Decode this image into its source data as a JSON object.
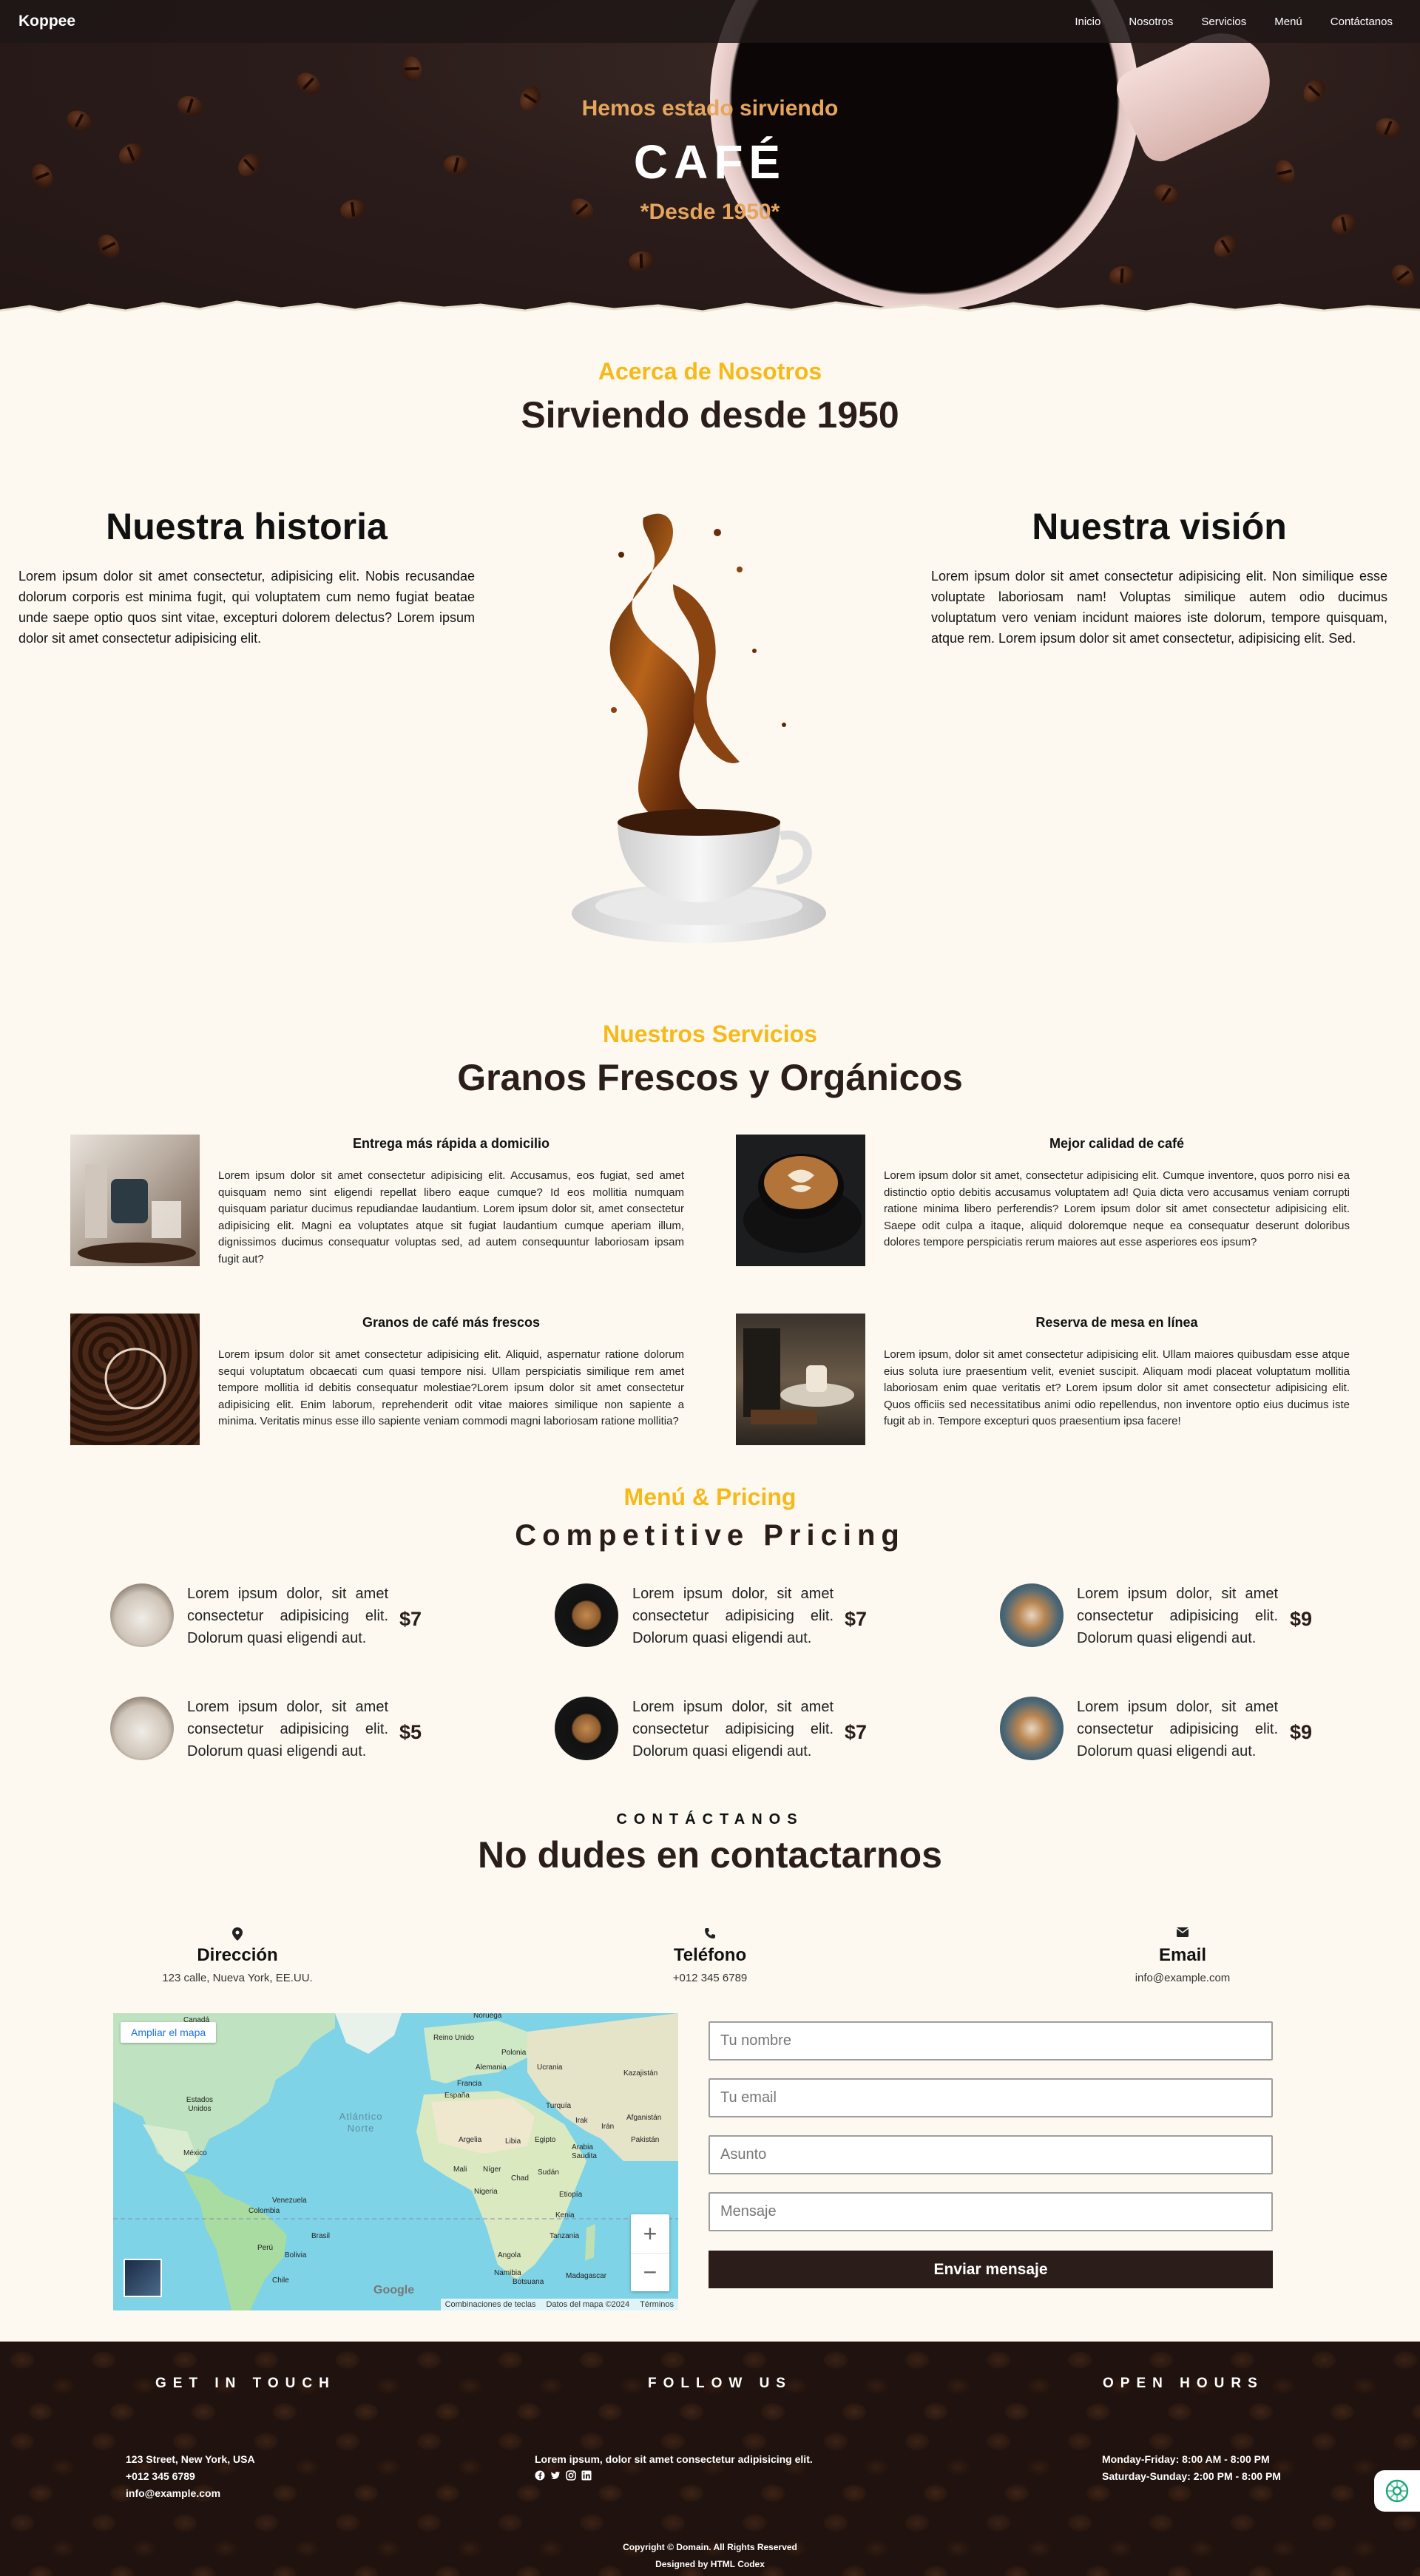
{
  "nav": {
    "brand": "Koppee",
    "links": [
      "Inicio",
      "Nosotros",
      "Servicios",
      "Menú",
      "Contáctanos"
    ]
  },
  "hero": {
    "subtitle": "Hemos estado sirviendo",
    "title": "CAFÉ",
    "since": "*Desde 1950*"
  },
  "about": {
    "kicker": "Acerca de Nosotros",
    "heading": "Sirviendo desde 1950",
    "history_title": "Nuestra historia",
    "history_text": "Lorem ipsum dolor sit amet consectetur, adipisicing elit. Nobis recusandae dolorum corporis est minima fugit, qui voluptatem cum nemo fugiat beatae unde saepe optio quos sint vitae, excepturi dolorem delectus? Lorem ipsum dolor sit amet consectetur adipisicing elit.",
    "vision_title": "Nuestra visión",
    "vision_text": "Lorem ipsum dolor sit amet consectetur adipisicing elit. Non similique esse voluptate laboriosam nam! Voluptas similique autem odio ducimus voluptatum vero veniam incidunt maiores iste dolorum, tempore quisquam, atque rem. Lorem ipsum dolor sit amet consectetur, adipisicing elit. Sed."
  },
  "services": {
    "kicker": "Nuestros Servicios",
    "heading": "Granos Frescos y Orgánicos",
    "items": [
      {
        "title": "Entrega más rápida a domicilio",
        "text": "Lorem ipsum dolor sit amet consectetur adipisicing elit. Accusamus, eos fugiat, sed amet quisquam nemo sint eligendi repellat libero eaque cumque? Id eos mollitia numquam quisquam pariatur ducimus repudiandae laudantium. Lorem ipsum dolor sit, amet consectetur adipisicing elit. Magni ea voluptates atque sit fugiat laudantium cumque aperiam illum, dignissimos ducimus consequatur voluptas sed, ad autem consequuntur laboriosam ipsam fugit aut?"
      },
      {
        "title": "Mejor calidad de café",
        "text": "Lorem ipsum dolor sit amet, consectetur adipisicing elit. Cumque inventore, quos porro nisi ea distinctio optio debitis accusamus voluptatem ad! Quia dicta vero accusamus veniam corrupti ratione minima libero perferendis? Lorem ipsum dolor sit amet consectetur adipisicing elit. Saepe odit culpa a itaque, aliquid doloremque neque ea consequatur deserunt doloribus dolores tempore perspiciatis rerum maiores aut esse asperiores eos ipsum?"
      },
      {
        "title": "Granos de café más frescos",
        "text": "Lorem ipsum dolor sit amet consectetur adipisicing elit. Aliquid, aspernatur ratione dolorum sequi voluptatum obcaecati cum quasi tempore nisi. Ullam perspiciatis similique rem amet tempore mollitia id debitis consequatur molestiae?Lorem ipsum dolor sit amet consectetur adipisicing elit. Enim laborum, reprehenderit odit vitae maiores similique non sapiente a minima. Veritatis minus esse illo sapiente veniam commodi magni laboriosam ratione mollitia?"
      },
      {
        "title": "Reserva de mesa en línea",
        "text": "Lorem ipsum, dolor sit amet consectetur adipisicing elit. Ullam maiores quibusdam esse atque eius soluta iure praesentium velit, eveniet suscipit. Aliquam modi placeat voluptatum mollitia laboriosam enim quae veritatis et? Lorem ipsum dolor sit amet consectetur adipisicing elit. Quos officiis sed necessitatibus animi odio repellendus, non inventore optio eius ducimus iste fugit ab in. Tempore excepturi quos praesentium ipsa facere!"
      }
    ]
  },
  "menu": {
    "kicker": "Menú & Pricing",
    "heading": "Competitive Pricing",
    "item_text": "Lorem ipsum, dolor, sit amet consectetur adipisicing elit. Dolorum quasi eligendi aut.",
    "items": [
      {
        "text": "Lorem ipsum dolor, sit amet consectetur adipisicing elit. Dolorum quasi eligendi aut.",
        "price": "$7"
      },
      {
        "text": "Lorem ipsum dolor, sit amet consectetur adipisicing elit. Dolorum quasi eligendi aut.",
        "price": "$7"
      },
      {
        "text": "Lorem ipsum dolor, sit amet consectetur adipisicing elit. Dolorum quasi eligendi aut.",
        "price": "$9"
      },
      {
        "text": "Lorem ipsum dolor, sit amet consectetur adipisicing elit. Dolorum quasi eligendi aut.",
        "price": "$5"
      },
      {
        "text": "Lorem ipsum dolor, sit amet consectetur adipisicing elit. Dolorum quasi eligendi aut.",
        "price": "$7"
      },
      {
        "text": "Lorem ipsum dolor, sit amet consectetur adipisicing elit. Dolorum quasi eligendi aut.",
        "price": "$9"
      }
    ]
  },
  "contact": {
    "kicker": "CONTÁCTANOS",
    "heading": "No dudes en contactarnos",
    "address_title": "Dirección",
    "address": "123 calle, Nueva York, EE.UU.",
    "phone_title": "Teléfono",
    "phone": "+012 345 6789",
    "email_title": "Email",
    "email": "info@example.com",
    "map": {
      "expand": "Ampliar el mapa",
      "ocean": "Atlántico Norte",
      "labels": [
        "Noruega",
        "Reino Unido",
        "Polonia",
        "Alemania",
        "Ucrania",
        "Kazajistán",
        "Francia",
        "España",
        "Turquía",
        "Irak",
        "Irán",
        "Argelia",
        "Libia",
        "Egipto",
        "Arabia Saudita",
        "Afganistán",
        "Pakistán",
        "Mali",
        "Níger",
        "Chad",
        "Sudán",
        "Nigeria",
        "Etiopía",
        "Kenia",
        "Tanzania",
        "Angola",
        "Namibia",
        "Botsuana",
        "Madagascar",
        "Canadá",
        "Estados Unidos",
        "México",
        "Venezuela",
        "Colombia",
        "Perú",
        "Brasil",
        "Bolivia",
        "Chile"
      ],
      "google": "Google",
      "attribution": [
        "Combinaciones de teclas",
        "Datos del mapa ©2024",
        "Términos"
      ]
    },
    "form": {
      "name_placeholder": "Tu nombre",
      "email_placeholder": "Tu email",
      "subject_placeholder": "Asunto",
      "message_placeholder": "Mensaje",
      "submit": "Enviar mensaje"
    }
  },
  "footer": {
    "get_in_touch": "GET IN TOUCH",
    "follow_us": "FOLLOW US",
    "open_hours": "OPEN HOURS",
    "address": "123 Street, New York, USA",
    "phone": "+012 345 6789",
    "email": "info@example.com",
    "follow_text": "Lorem ipsum, dolor sit amet consectetur adipisicing elit.",
    "hours_weekday": "Monday-Friday: 8:00 AM - 8:00 PM",
    "hours_weekend": "Saturday-Sunday: 2:00 PM - 8:00 PM",
    "copyright": "Copyright © Domain. All Rights Reserved",
    "designed_by": "Designed by HTML Codex",
    "social_icons": [
      "facebook-icon",
      "twitter-icon",
      "instagram-icon",
      "linkedin-icon"
    ]
  },
  "colors": {
    "accent": "#f6b91a",
    "hero_accent": "#e5a55d",
    "dark": "#2b1e1a",
    "page_bg": "#fdf9f0"
  }
}
